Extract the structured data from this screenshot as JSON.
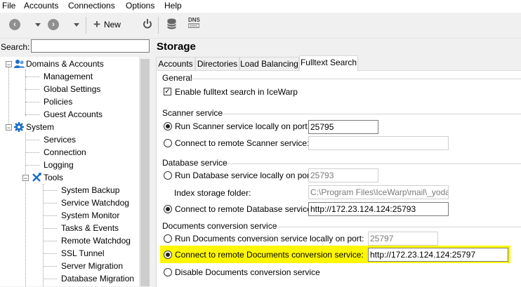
{
  "menu": [
    "File",
    "Accounts",
    "Connections",
    "Options",
    "Help"
  ],
  "toolbar": {
    "new_label": "New",
    "dns_label": "DNS"
  },
  "search": {
    "label": "Search:",
    "value": ""
  },
  "tree": {
    "domains": "Domains & Accounts",
    "management": "Management",
    "global_settings": "Global Settings",
    "policies": "Policies",
    "guest_accounts": "Guest Accounts",
    "system": "System",
    "services": "Services",
    "connection": "Connection",
    "logging": "Logging",
    "tools": "Tools",
    "system_backup": "System Backup",
    "service_watchdog": "Service Watchdog",
    "system_monitor": "System Monitor",
    "tasks_events": "Tasks & Events",
    "remote_watchdog": "Remote Watchdog",
    "ssl_tunnel": "SSL Tunnel",
    "server_migration": "Server Migration",
    "database_migration": "Database Migration"
  },
  "page_title": "Storage",
  "tabs": [
    "Accounts",
    "Directories",
    "Load Balancing",
    "Fulltext Search"
  ],
  "general": {
    "title": "General",
    "enable_label": "Enable fulltext search in IceWarp"
  },
  "scanner": {
    "title": "Scanner service",
    "local_label": "Run Scanner service locally on port:",
    "local_value": "25795",
    "remote_label": "Connect to remote Scanner service:",
    "remote_value": ""
  },
  "database": {
    "title": "Database service",
    "local_label": "Run Database service locally on port:",
    "local_value": "25793",
    "index_label": "Index storage folder:",
    "index_value": "C:\\Program Files\\IceWarp\\mail\\_yodaidx",
    "remote_label": "Connect to remote Database service:",
    "remote_value": "http://172.23.124.124:25793"
  },
  "documents": {
    "title": "Documents conversion service",
    "local_label": "Run Documents conversion service locally on port:",
    "local_value": "25797",
    "remote_label": "Connect to remote Documents conversion service:",
    "remote_value": "http://172.23.124.124:25797",
    "disable_label": "Disable Documents conversion service"
  },
  "colors": {
    "highlight": "#fff700",
    "accent_icon": "#1e6fc9"
  }
}
